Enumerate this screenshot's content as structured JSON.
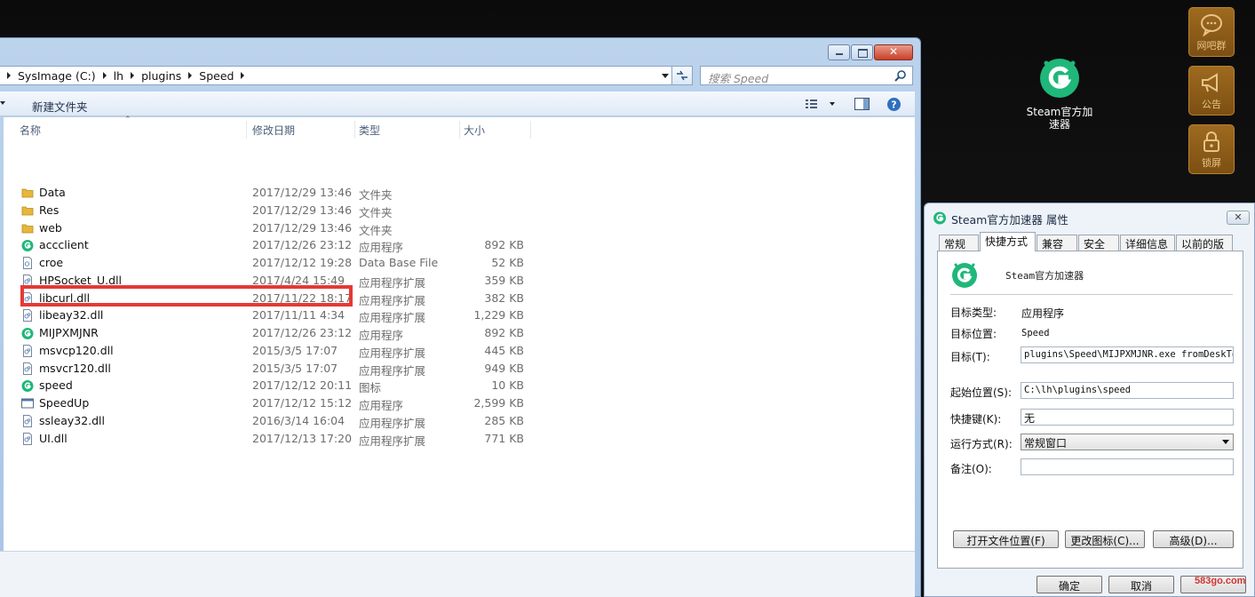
{
  "desktop": {
    "side_buttons": [
      {
        "label": "网吧群",
        "icon": "chat-bubble-icon"
      },
      {
        "label": "公告",
        "icon": "megaphone-icon"
      },
      {
        "label": "锁屏",
        "icon": "lock-icon"
      }
    ],
    "shortcut_label": "Steam官方加速器",
    "shortcut_icon": "steam-speed-g-icon"
  },
  "explorer": {
    "breadcrumb": [
      "SysImage (C:)",
      "lh",
      "plugins",
      "Speed"
    ],
    "search_placeholder": "搜索 Speed",
    "toolbar": {
      "new_folder": "新建文件夹"
    },
    "columns": {
      "name": "名称",
      "date": "修改日期",
      "type": "类型",
      "size": "大小"
    },
    "files": [
      {
        "name": "Data",
        "date": "2017/12/29 13:46",
        "type": "文件夹",
        "size": "",
        "icon": "folder-icon"
      },
      {
        "name": "Res",
        "date": "2017/12/29 13:46",
        "type": "文件夹",
        "size": "",
        "icon": "folder-icon"
      },
      {
        "name": "web",
        "date": "2017/12/29 13:46",
        "type": "文件夹",
        "size": "",
        "icon": "folder-icon"
      },
      {
        "name": "accclient",
        "date": "2017/12/26 23:12",
        "type": "应用程序",
        "size": "892 KB",
        "icon": "app-g-icon"
      },
      {
        "name": "croe",
        "date": "2017/12/12 19:28",
        "type": "Data Base File",
        "size": "52 KB",
        "icon": "file-icon"
      },
      {
        "name": "HPSocket_U.dll",
        "date": "2017/4/24 15:49",
        "type": "应用程序扩展",
        "size": "359 KB",
        "icon": "dll-icon"
      },
      {
        "name": "libcurl.dll",
        "date": "2017/11/22 18:17",
        "type": "应用程序扩展",
        "size": "382 KB",
        "icon": "dll-icon"
      },
      {
        "name": "libeay32.dll",
        "date": "2017/11/11 4:34",
        "type": "应用程序扩展",
        "size": "1,229 KB",
        "icon": "dll-icon"
      },
      {
        "name": "MIJPXMJNR",
        "date": "2017/12/26 23:12",
        "type": "应用程序",
        "size": "892 KB",
        "icon": "app-g-icon"
      },
      {
        "name": "msvcp120.dll",
        "date": "2015/3/5 17:07",
        "type": "应用程序扩展",
        "size": "445 KB",
        "icon": "dll-icon"
      },
      {
        "name": "msvcr120.dll",
        "date": "2015/3/5 17:07",
        "type": "应用程序扩展",
        "size": "949 KB",
        "icon": "dll-icon"
      },
      {
        "name": "speed",
        "date": "2017/12/12 20:11",
        "type": "图标",
        "size": "10 KB",
        "icon": "app-g-icon"
      },
      {
        "name": "SpeedUp",
        "date": "2017/12/12 15:12",
        "type": "应用程序",
        "size": "2,599 KB",
        "icon": "window-app-icon"
      },
      {
        "name": "ssleay32.dll",
        "date": "2016/3/14 16:04",
        "type": "应用程序扩展",
        "size": "285 KB",
        "icon": "dll-icon"
      },
      {
        "name": "UI.dll",
        "date": "2017/12/13 17:20",
        "type": "应用程序扩展",
        "size": "771 KB",
        "icon": "dll-icon"
      }
    ]
  },
  "props": {
    "title": "Steam官方加速器 属性",
    "tabs": [
      "常规",
      "快捷方式",
      "兼容性",
      "安全",
      "详细信息",
      "以前的版本"
    ],
    "active_tab": "快捷方式",
    "app_name": "Steam官方加速器",
    "fields": {
      "target_type_label": "目标类型:",
      "target_type_value": "应用程序",
      "target_location_label": "目标位置:",
      "target_location_value": "Speed",
      "target_label": "目标(T):",
      "target_value": "plugins\\Speed\\MIJPXMJNR.exe fromDeskTop",
      "start_in_label": "起始位置(S):",
      "start_in_value": "C:\\lh\\plugins\\speed",
      "hotkey_label": "快捷键(K):",
      "hotkey_value": "无",
      "run_label": "运行方式(R):",
      "run_value": "常规窗口",
      "comment_label": "备注(O):",
      "comment_value": ""
    },
    "buttons": {
      "open_location": "打开文件位置(F)",
      "change_icon": "更改图标(C)...",
      "advanced": "高级(D)...",
      "ok": "确定",
      "cancel": "取消"
    }
  },
  "watermark": "583go.com",
  "colors": {
    "accent_green": "#1fb77a",
    "highlight_red": "#e53935",
    "side_btn": "#8a5a18"
  }
}
